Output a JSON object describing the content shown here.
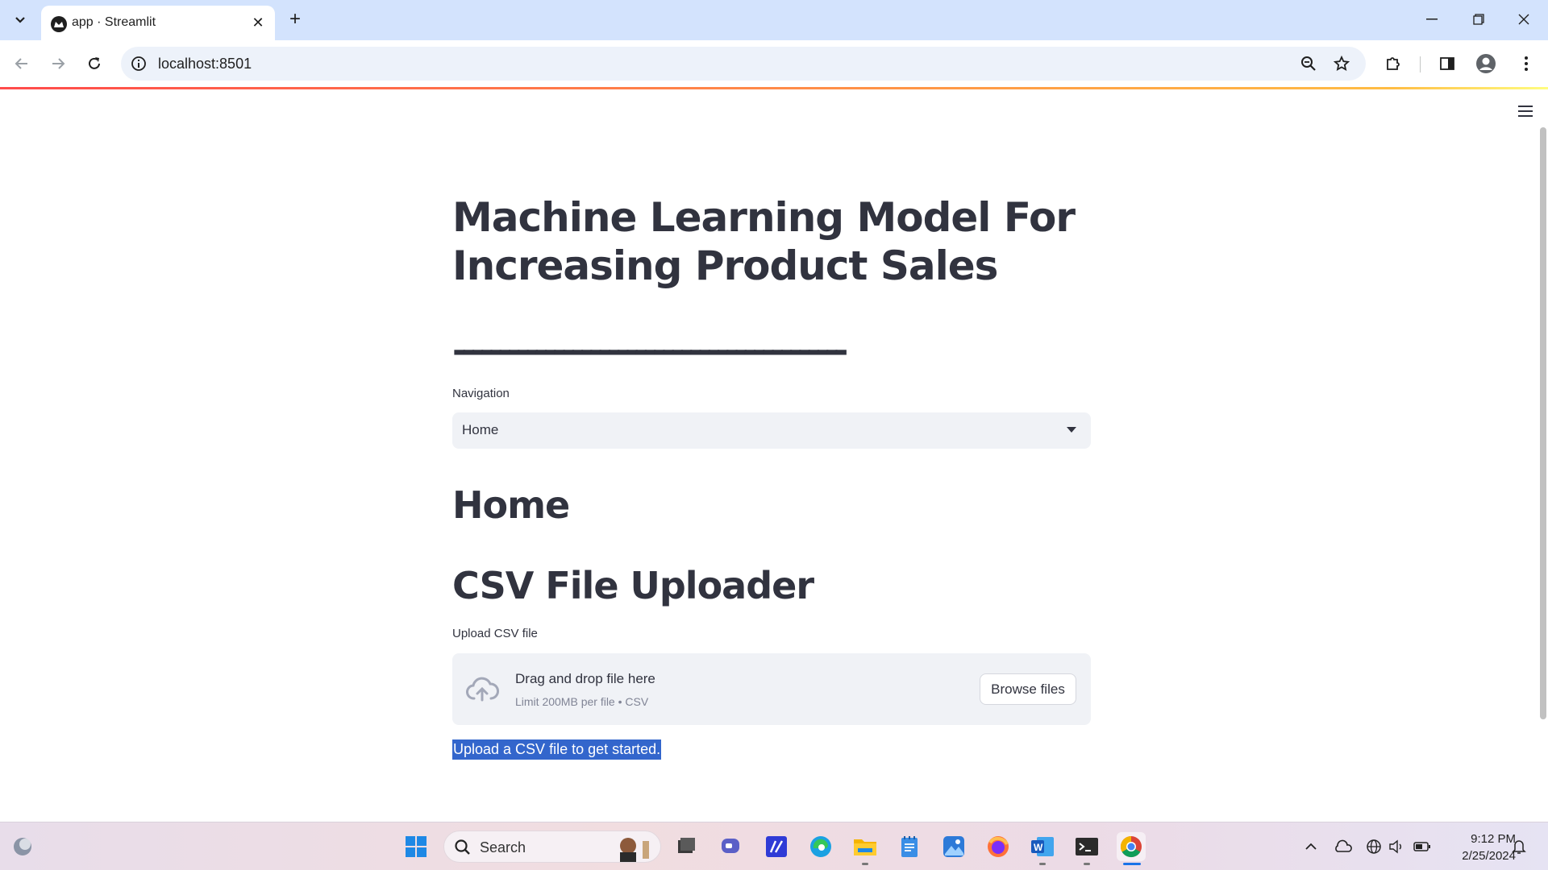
{
  "browser": {
    "tab_title": "app · Streamlit",
    "url": "localhost:8501"
  },
  "app": {
    "title": "Machine Learning Model For Increasing Product Sales",
    "divider": "-------------------------------------------",
    "nav_label": "Navigation",
    "nav_selected": "Home",
    "home_heading": "Home",
    "uploader_heading": "CSV File Uploader",
    "upload_label": "Upload CSV file",
    "dropzone_main": "Drag and drop file here",
    "dropzone_sub": "Limit 200MB per file • CSV",
    "browse_label": "Browse files",
    "info_message": "Upload a CSV file to get started."
  },
  "taskbar": {
    "search_placeholder": "Search",
    "time": "9:12 PM",
    "date": "2/25/2024"
  },
  "colors": {
    "accent": "#ff4b4b",
    "text": "#31333f",
    "selection": "#3366cc"
  }
}
